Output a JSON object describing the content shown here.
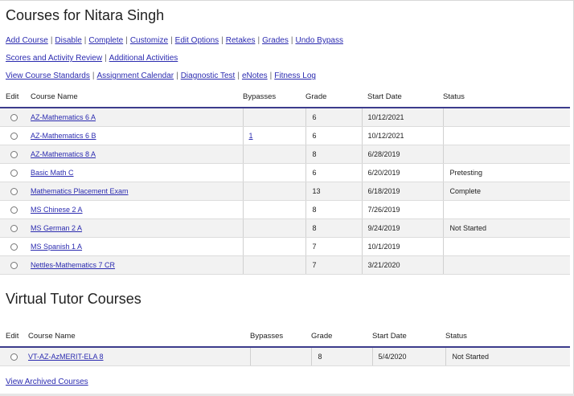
{
  "page": {
    "title": "Courses for Nitara Singh"
  },
  "actions": {
    "row1": [
      "Add Course",
      "Disable",
      "Complete",
      "Customize",
      "Edit Options",
      "Retakes",
      "Grades",
      "Undo Bypass"
    ],
    "row2": [
      "Scores and Activity Review",
      "Additional Activities"
    ],
    "row3": [
      "View Course Standards",
      "Assignment Calendar",
      "Diagnostic Test",
      "eNotes",
      "Fitness Log"
    ]
  },
  "courses": {
    "headers": {
      "edit": "Edit",
      "name": "Course Name",
      "bypasses": "Bypasses",
      "grade": "Grade",
      "start": "Start Date",
      "status": "Status"
    },
    "rows": [
      {
        "name": "AZ-Mathematics 6 A",
        "bypasses": "",
        "grade": "6",
        "start": "10/12/2021",
        "status": ""
      },
      {
        "name": "AZ-Mathematics 6 B",
        "bypasses": "1",
        "grade": "6",
        "start": "10/12/2021",
        "status": ""
      },
      {
        "name": "AZ-Mathematics 8 A",
        "bypasses": "",
        "grade": "8",
        "start": "6/28/2019",
        "status": ""
      },
      {
        "name": "Basic Math C",
        "bypasses": "",
        "grade": "6",
        "start": "6/20/2019",
        "status": "Pretesting"
      },
      {
        "name": "Mathematics Placement Exam",
        "bypasses": "",
        "grade": "13",
        "start": "6/18/2019",
        "status": "Complete"
      },
      {
        "name": "MS Chinese 2 A",
        "bypasses": "",
        "grade": "8",
        "start": "7/26/2019",
        "status": ""
      },
      {
        "name": "MS German 2 A",
        "bypasses": "",
        "grade": "8",
        "start": "9/24/2019",
        "status": "Not Started"
      },
      {
        "name": "MS Spanish 1 A",
        "bypasses": "",
        "grade": "7",
        "start": "10/1/2019",
        "status": ""
      },
      {
        "name": "Nettles-Mathematics 7 CR",
        "bypasses": "",
        "grade": "7",
        "start": "3/21/2020",
        "status": ""
      }
    ]
  },
  "virtual_tutor": {
    "title": "Virtual Tutor Courses",
    "headers": {
      "edit": "Edit",
      "name": "Course Name",
      "bypasses": "Bypasses",
      "grade": "Grade",
      "start": "Start Date",
      "status": "Status"
    },
    "rows": [
      {
        "name": "VT-AZ-AzMERIT-ELA 8",
        "bypasses": "",
        "grade": "8",
        "start": "5/4/2020",
        "status": "Not Started"
      }
    ]
  },
  "footer": {
    "archived_link": "View Archived Courses"
  }
}
